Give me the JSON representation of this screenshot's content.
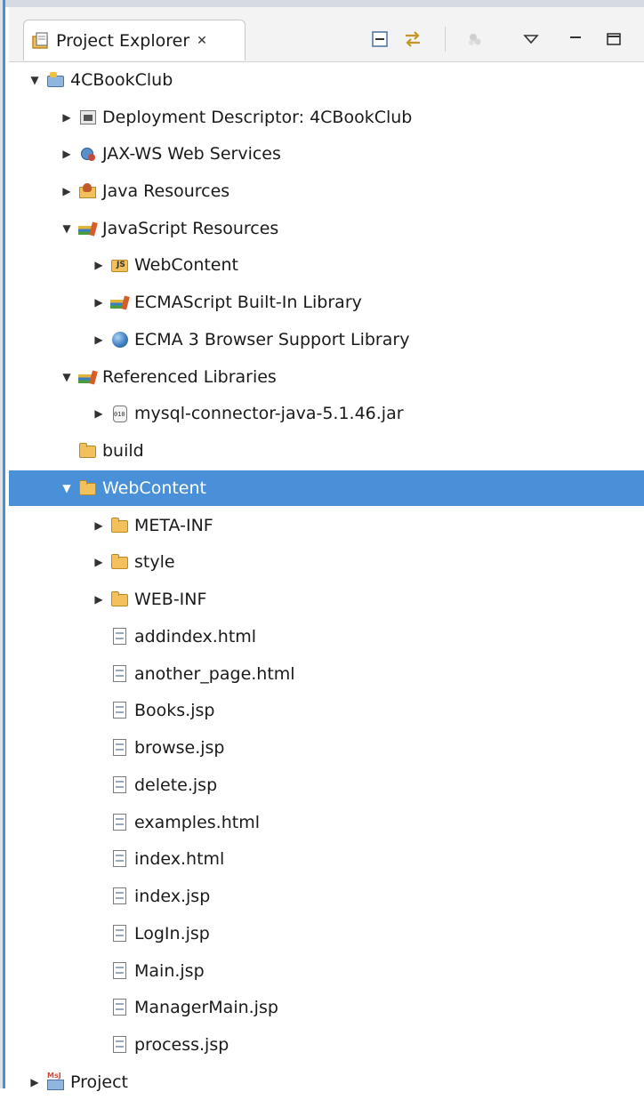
{
  "view": {
    "title": "Project Explorer",
    "close_symbol": "✕",
    "toolbar": [
      {
        "name": "collapse-all-icon"
      },
      {
        "name": "link-with-editor-icon"
      },
      {
        "name": "filter-icon"
      },
      {
        "name": "view-menu-icon"
      },
      {
        "name": "minimize-icon"
      },
      {
        "name": "maximize-icon"
      }
    ]
  },
  "tree": {
    "selected_index": 12,
    "items": [
      {
        "label": "4CBookClub",
        "icon": "project-icon",
        "expander": "expanded"
      },
      {
        "label": "Deployment Descriptor: 4CBookClub",
        "icon": "deployment-descriptor-icon",
        "expander": "collapsed"
      },
      {
        "label": "JAX-WS Web Services",
        "icon": "web-services-icon",
        "expander": "collapsed"
      },
      {
        "label": "Java Resources",
        "icon": "java-resources-icon",
        "expander": "collapsed"
      },
      {
        "label": "JavaScript Resources",
        "icon": "library-icon",
        "expander": "expanded"
      },
      {
        "label": "WebContent",
        "icon": "js-folder-icon",
        "expander": "collapsed"
      },
      {
        "label": "ECMAScript Built-In Library",
        "icon": "library-icon",
        "expander": "collapsed"
      },
      {
        "label": "ECMA 3 Browser Support Library",
        "icon": "globe-icon",
        "expander": "collapsed"
      },
      {
        "label": "Referenced Libraries",
        "icon": "library-icon",
        "expander": "expanded"
      },
      {
        "label": "mysql-connector-java-5.1.46.jar",
        "icon": "jar-icon",
        "expander": "collapsed"
      },
      {
        "label": "build",
        "icon": "folder-icon",
        "expander": "none"
      },
      {
        "label": "WebContent",
        "icon": "folder-icon",
        "expander": "expanded"
      },
      {
        "label": "META-INF",
        "icon": "folder-icon",
        "expander": "collapsed"
      },
      {
        "label": "style",
        "icon": "folder-icon",
        "expander": "collapsed"
      },
      {
        "label": "WEB-INF",
        "icon": "folder-icon",
        "expander": "collapsed"
      },
      {
        "label": "addindex.html",
        "icon": "file-icon",
        "expander": "none"
      },
      {
        "label": "another_page.html",
        "icon": "file-icon",
        "expander": "none"
      },
      {
        "label": "Books.jsp",
        "icon": "file-icon",
        "expander": "none"
      },
      {
        "label": "browse.jsp",
        "icon": "file-icon",
        "expander": "none"
      },
      {
        "label": "delete.jsp",
        "icon": "file-icon",
        "expander": "none"
      },
      {
        "label": "examples.html",
        "icon": "file-icon",
        "expander": "none"
      },
      {
        "label": "index.html",
        "icon": "file-icon",
        "expander": "none"
      },
      {
        "label": "index.jsp",
        "icon": "file-icon",
        "expander": "none"
      },
      {
        "label": "LogIn.jsp",
        "icon": "file-icon",
        "expander": "none"
      },
      {
        "label": "Main.jsp",
        "icon": "file-icon",
        "expander": "none"
      },
      {
        "label": "ManagerMain.jsp",
        "icon": "file-icon",
        "expander": "none"
      },
      {
        "label": "process.jsp",
        "icon": "file-icon",
        "expander": "none"
      },
      {
        "label": "Project",
        "icon": "msj-project-icon",
        "expander": "collapsed"
      }
    ]
  }
}
